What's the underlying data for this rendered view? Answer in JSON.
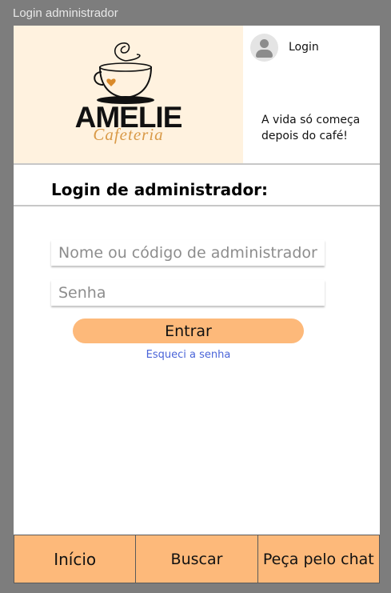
{
  "window": {
    "title": "Login administrador"
  },
  "header": {
    "logo": {
      "word": "AMELIE",
      "sub": "Cafeteria"
    },
    "login_label": "Login",
    "tagline": "A vida só começa depois do café!"
  },
  "page": {
    "title": "Login de administrador:"
  },
  "form": {
    "user_placeholder": "Nome ou código de administrador",
    "user_value": "",
    "password_placeholder": "Senha",
    "password_value": "",
    "submit_label": "Entrar",
    "forgot_label": "Esqueci a senha"
  },
  "tabs": [
    {
      "label": "Início"
    },
    {
      "label": "Buscar"
    },
    {
      "label": "Peça pelo chat"
    }
  ],
  "colors": {
    "accent": "#fdb97a",
    "logo_bg": "#fff2df",
    "link": "#4a64d8",
    "logo_sub": "#d99a48"
  },
  "icons": {
    "avatar": "user-avatar-icon",
    "logo": "coffee-cup-logo"
  }
}
